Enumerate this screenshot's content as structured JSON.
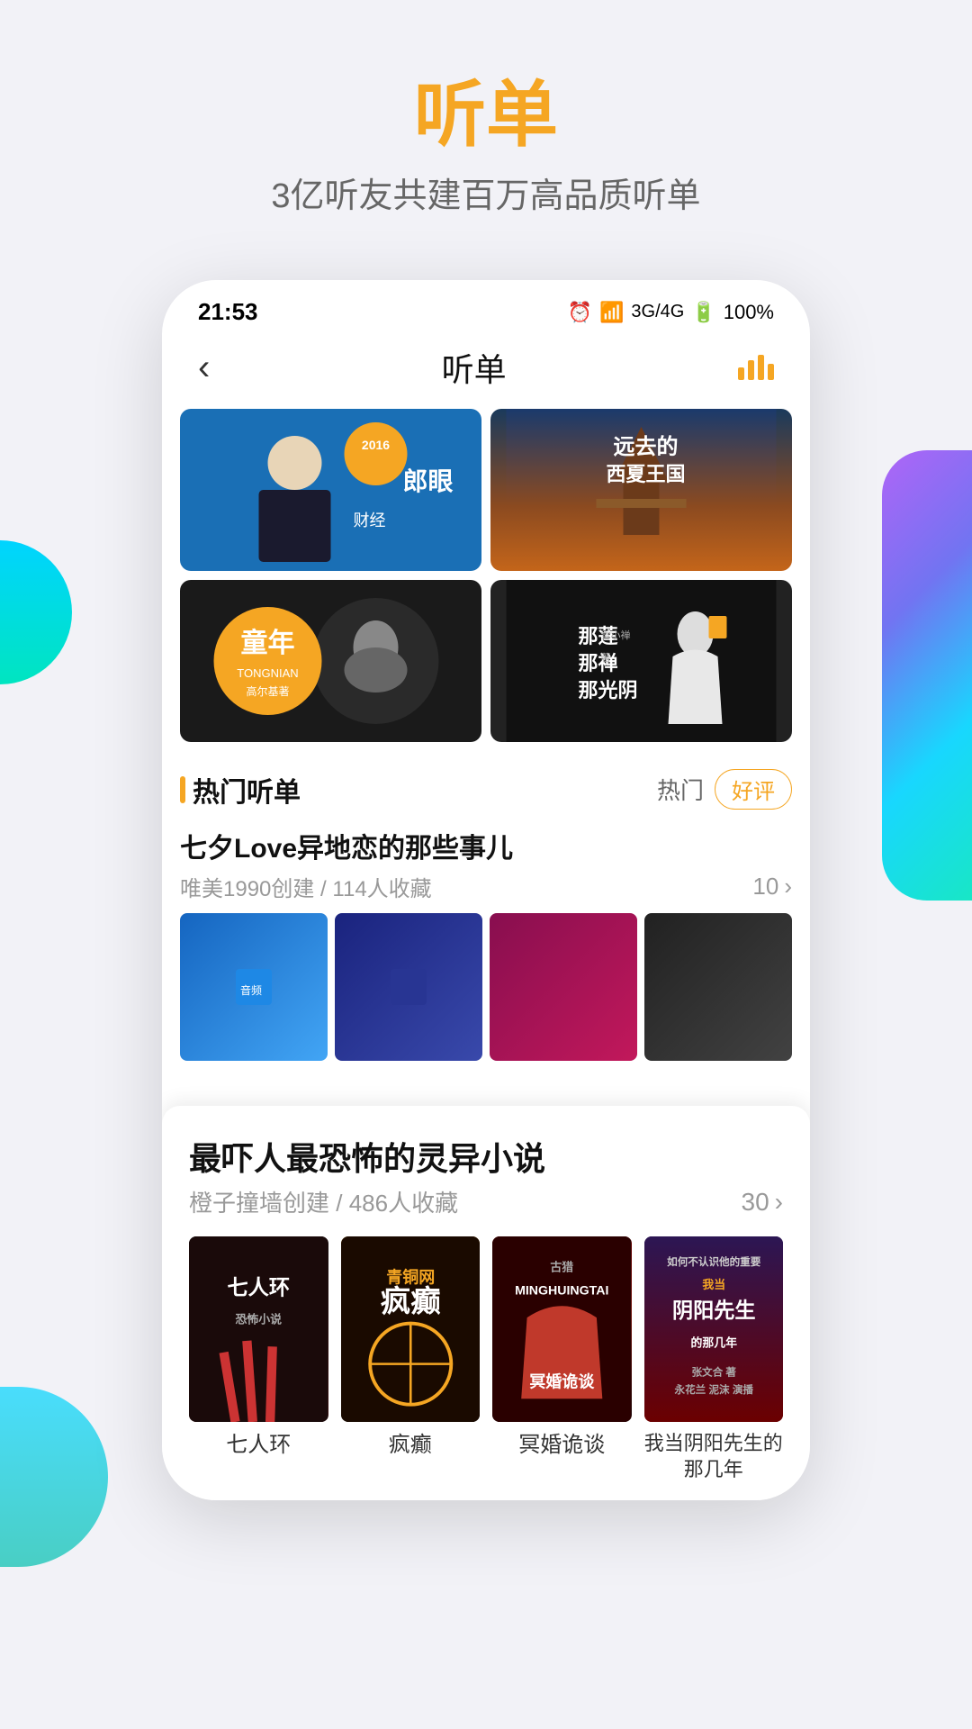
{
  "page": {
    "title": "听单",
    "subtitle": "3亿听友共建百万高品质听单"
  },
  "status_bar": {
    "time": "21:53",
    "battery": "100%",
    "signal_icon": "📶",
    "wifi_icon": "📡",
    "alarm_icon": "⏰"
  },
  "nav": {
    "back_label": "‹",
    "title": "听单",
    "chart_icon": "bar-chart"
  },
  "banners": [
    {
      "id": "banner-1",
      "title": "财经郎眼",
      "subtitle": "2016",
      "bg_color": "#1a6fb5",
      "text_color": "white"
    },
    {
      "id": "banner-2",
      "title": "远去的西夏王国",
      "bg_color": "#8b4a1a",
      "text_color": "white"
    },
    {
      "id": "banner-3",
      "title": "童年",
      "subtitle": "TONGNIAN 高尔基著",
      "bg_color": "#1a1a1a",
      "text_color": "white"
    },
    {
      "id": "banner-4",
      "title": "那莲 那禅 那光阴",
      "bg_color": "#222",
      "text_color": "white"
    }
  ],
  "hot_section": {
    "title": "热门听单",
    "filter_hot": "热门",
    "filter_rating": "好评"
  },
  "playlist_1": {
    "title": "七夕Love异地恋的那些事儿",
    "creator": "唯美1990创建",
    "collections": "114人收藏",
    "count": "10"
  },
  "playlist_2": {
    "title": "最吓人最恐怖的灵异小说",
    "creator": "橙子撞墙创建",
    "collections": "486人收藏",
    "count": "30"
  },
  "books": [
    {
      "title": "七人环",
      "cover_class": "book-cover-1",
      "text": "七人环"
    },
    {
      "title": "疯癫",
      "cover_class": "book-cover-2",
      "text": "疯癫"
    },
    {
      "title": "冥婚诡谈",
      "cover_class": "book-cover-3",
      "text": "冥婚诡谈"
    },
    {
      "title": "我当阴阳先生的那几年",
      "cover_class": "book-cover-4",
      "text": "我当阴阳先生的那几年"
    }
  ]
}
